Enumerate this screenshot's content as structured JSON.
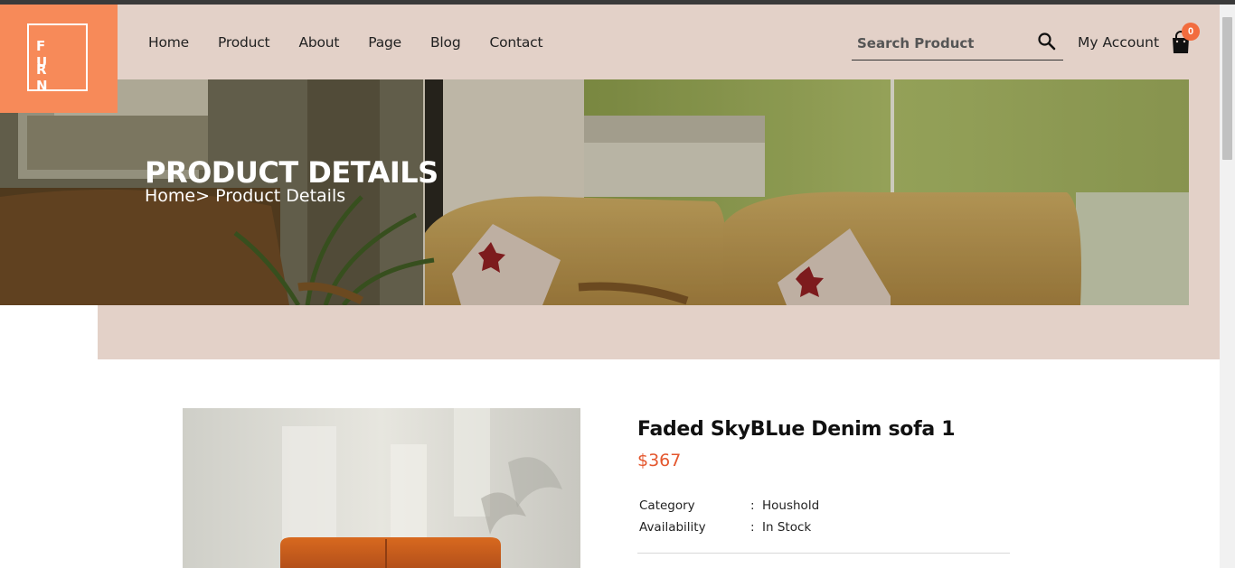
{
  "brand": {
    "logo_line1": "F U",
    "logo_line2": "R N",
    "accent": "#f78a59"
  },
  "nav": {
    "items": [
      {
        "label": "Home"
      },
      {
        "label": "Product"
      },
      {
        "label": "About"
      },
      {
        "label": "Page"
      },
      {
        "label": "Blog"
      },
      {
        "label": "Contact"
      }
    ]
  },
  "search": {
    "placeholder": "Search Product",
    "icon": "search-icon"
  },
  "account": {
    "label": "My Account"
  },
  "cart": {
    "count": "0",
    "icon": "shopping-bag-icon",
    "badge_color": "#f26c3e"
  },
  "hero": {
    "title": "PRODUCT DETAILS",
    "breadcrumb": "Home> Product Details"
  },
  "product": {
    "name": "Faded SkyBLue Denim sofa 1",
    "price": "$367",
    "price_color": "#e4572e",
    "details": [
      {
        "key": "Category",
        "sep": ":",
        "value": "Houshold"
      },
      {
        "key": "Availability",
        "sep": ":",
        "value": "In Stock"
      }
    ]
  },
  "colors": {
    "header_bg": "#e3d1c8"
  }
}
